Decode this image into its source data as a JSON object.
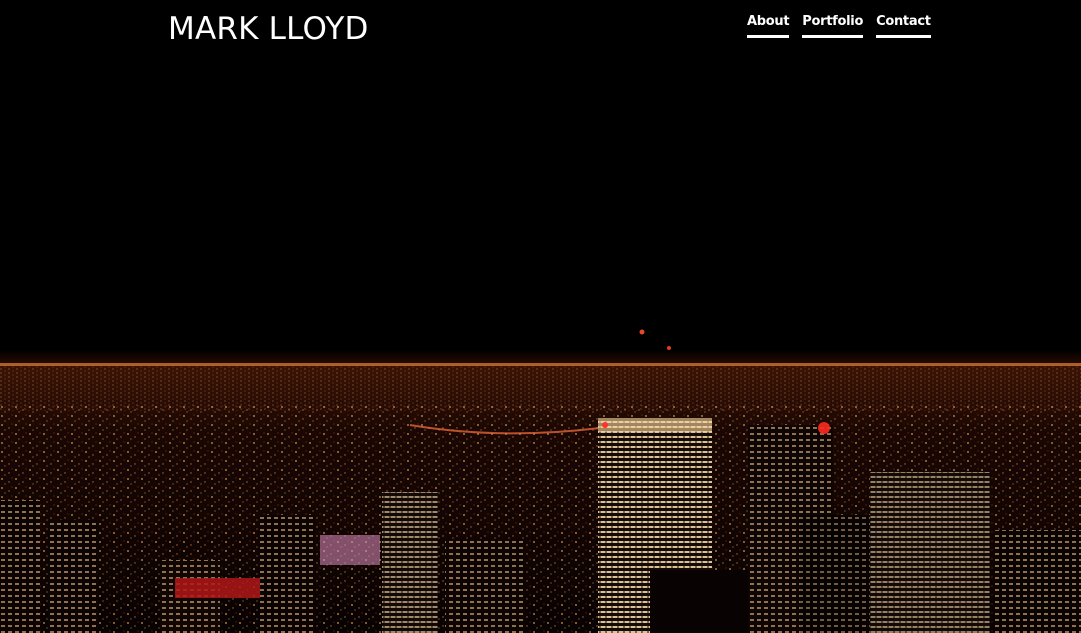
{
  "site": {
    "title": "MARK LLOYD"
  },
  "nav": {
    "items": [
      {
        "label": "About"
      },
      {
        "label": "Portfolio"
      },
      {
        "label": "Contact"
      }
    ]
  },
  "hero": {
    "image": "night-city-skyline",
    "colors": {
      "sky": "#000000",
      "lights_warm": "#ffb070",
      "lights_red": "#ff3030"
    }
  }
}
